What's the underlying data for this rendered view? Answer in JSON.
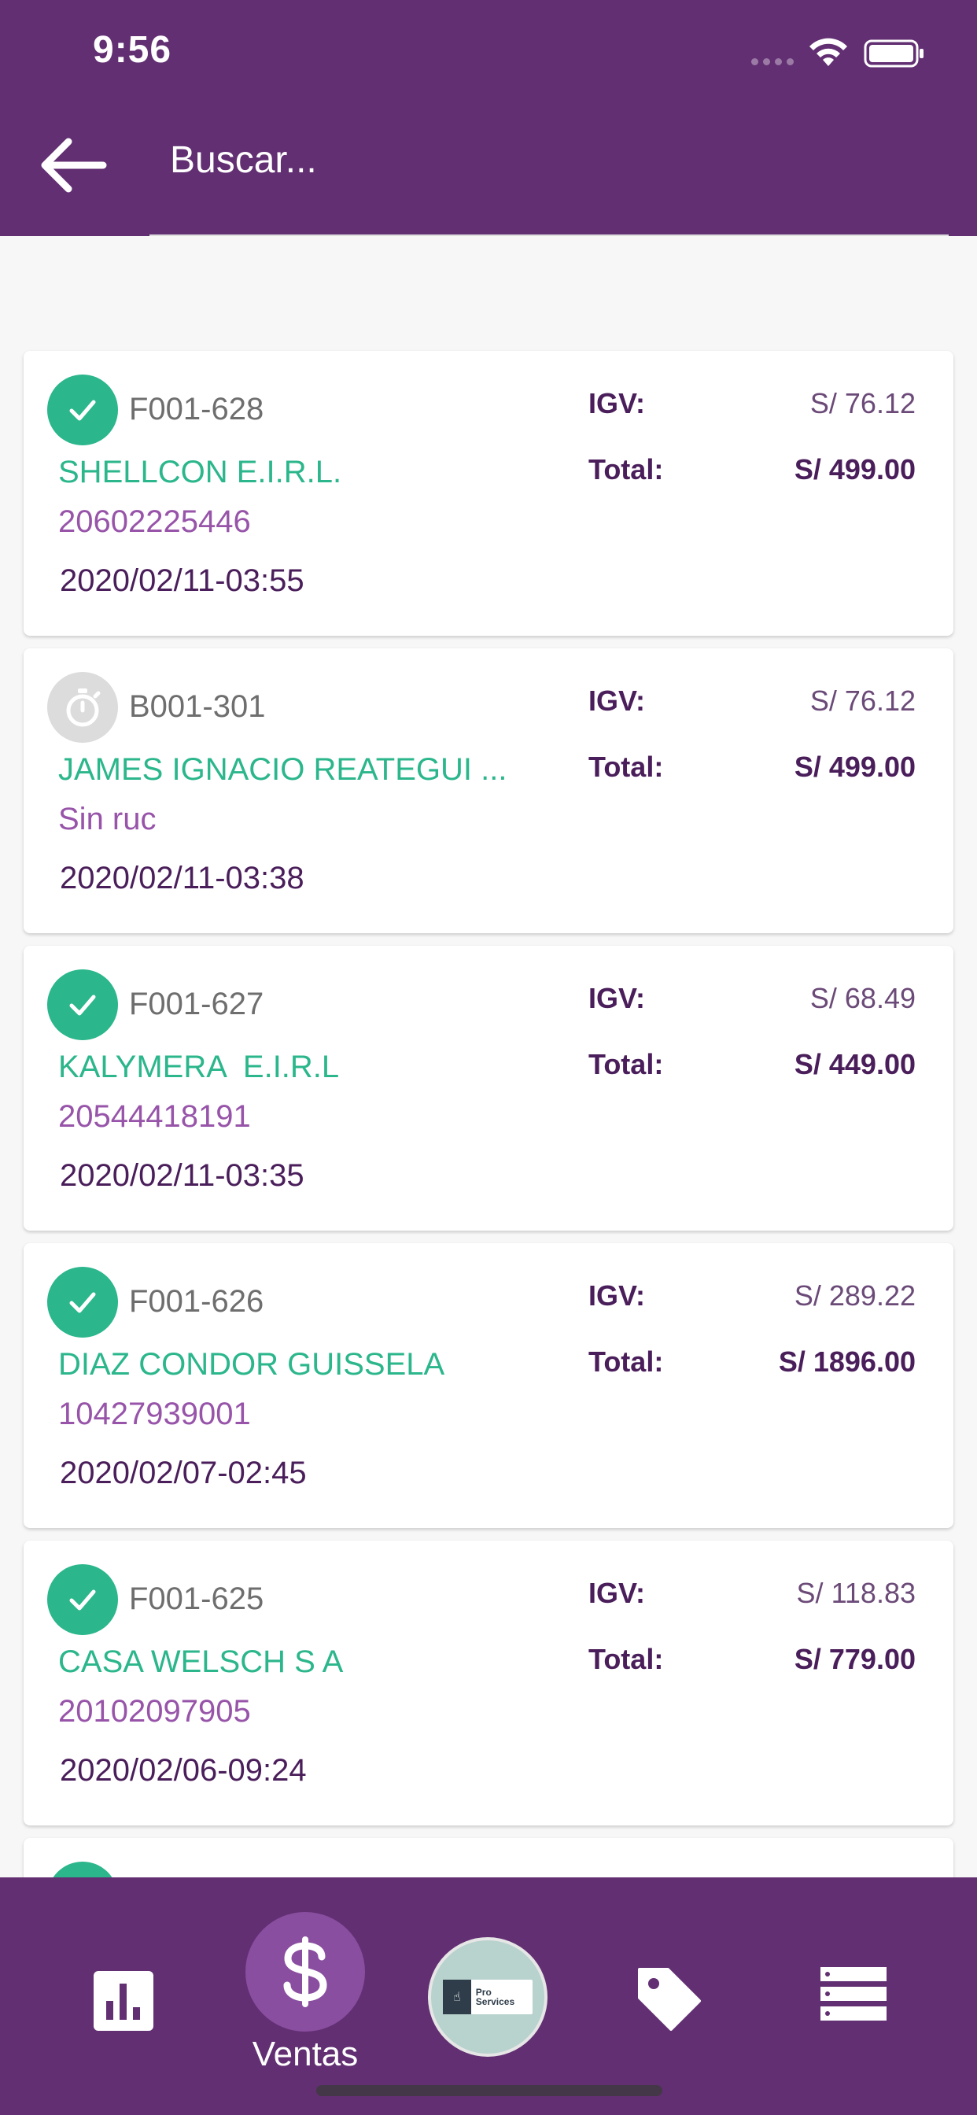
{
  "status_bar": {
    "time": "9:56"
  },
  "header": {
    "search_placeholder": "Buscar..."
  },
  "invoices": [
    {
      "status": "ok",
      "number": "F001-628",
      "client": "SHELLCON E.I.R.L.",
      "ruc": "20602225446",
      "datetime": "2020/02/11-03:55",
      "igv_label": "IGV:",
      "igv": "S/ 76.12",
      "total_label": "Total:",
      "total": "S/ 499.00"
    },
    {
      "status": "pending",
      "number": "B001-301",
      "client": "JAMES IGNACIO REATEGUI ...",
      "ruc": "Sin ruc",
      "datetime": "2020/02/11-03:38",
      "igv_label": "IGV:",
      "igv": "S/ 76.12",
      "total_label": "Total:",
      "total": "S/ 499.00"
    },
    {
      "status": "ok",
      "number": "F001-627",
      "client": "KALYMERA  E.I.R.L",
      "ruc": "20544418191",
      "datetime": "2020/02/11-03:35",
      "igv_label": "IGV:",
      "igv": "S/ 68.49",
      "total_label": "Total:",
      "total": "S/ 449.00"
    },
    {
      "status": "ok",
      "number": "F001-626",
      "client": "DIAZ CONDOR GUISSELA",
      "ruc": "10427939001",
      "datetime": "2020/02/07-02:45",
      "igv_label": "IGV:",
      "igv": "S/ 289.22",
      "total_label": "Total:",
      "total": "S/ 1896.00"
    },
    {
      "status": "ok",
      "number": "F001-625",
      "client": "CASA WELSCH S A",
      "ruc": "20102097905",
      "datetime": "2020/02/06-09:24",
      "igv_label": "IGV:",
      "igv": "S/ 118.83",
      "total_label": "Total:",
      "total": "S/ 779.00"
    }
  ],
  "bottom_nav": {
    "items": [
      {
        "icon": "bar-chart-icon"
      },
      {
        "icon": "dollar-icon",
        "label": "Ventas",
        "active": true
      },
      {
        "icon": "pro-services-logo",
        "logo_text": "Pro Services"
      },
      {
        "icon": "tag-icon"
      },
      {
        "icon": "list-icon"
      }
    ]
  },
  "colors": {
    "primary": "#622f72",
    "accent_green": "#2bb68b",
    "ruc_purple": "#9754a9",
    "active_circle": "#8a4ea0"
  }
}
